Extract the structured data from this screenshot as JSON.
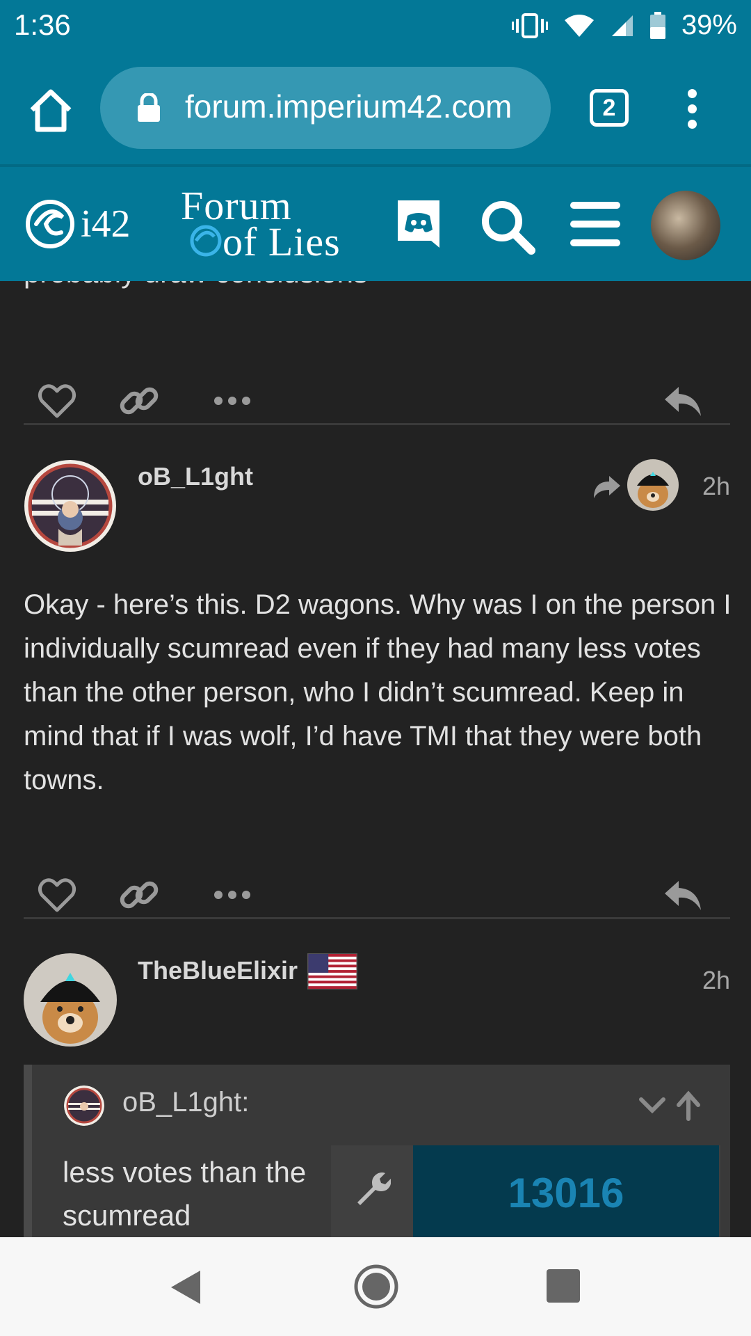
{
  "status_bar": {
    "time": "1:36",
    "battery": "39%"
  },
  "browser": {
    "url": "forum.imperium42.com",
    "tab_count": "2"
  },
  "site_header": {
    "logo_text": "i42",
    "forum_title_line1": "Forum",
    "forum_title_line2": "of Lies"
  },
  "content": {
    "cut_off_text": "probably draw conclusions",
    "posts": [
      {
        "username": "oB_L1ght",
        "time": "2h",
        "body": "Okay - here’s this. D2 wagons. Why was I on the person I individually scumread even if they had many less votes than the other person, who I didn’t scumread. Keep in mind that if I was wolf, I’d have TMI that they were both towns."
      },
      {
        "username": "TheBlueElixir",
        "time": "2h",
        "quote": {
          "username": "oB_L1ght:",
          "text_line1": "less votes than the",
          "text_line2": "scumread"
        }
      }
    ]
  },
  "overlay_widget": {
    "counter": "13016"
  },
  "colors": {
    "brand": "#037897",
    "background": "#222222",
    "counter_text": "#1a84b3"
  }
}
